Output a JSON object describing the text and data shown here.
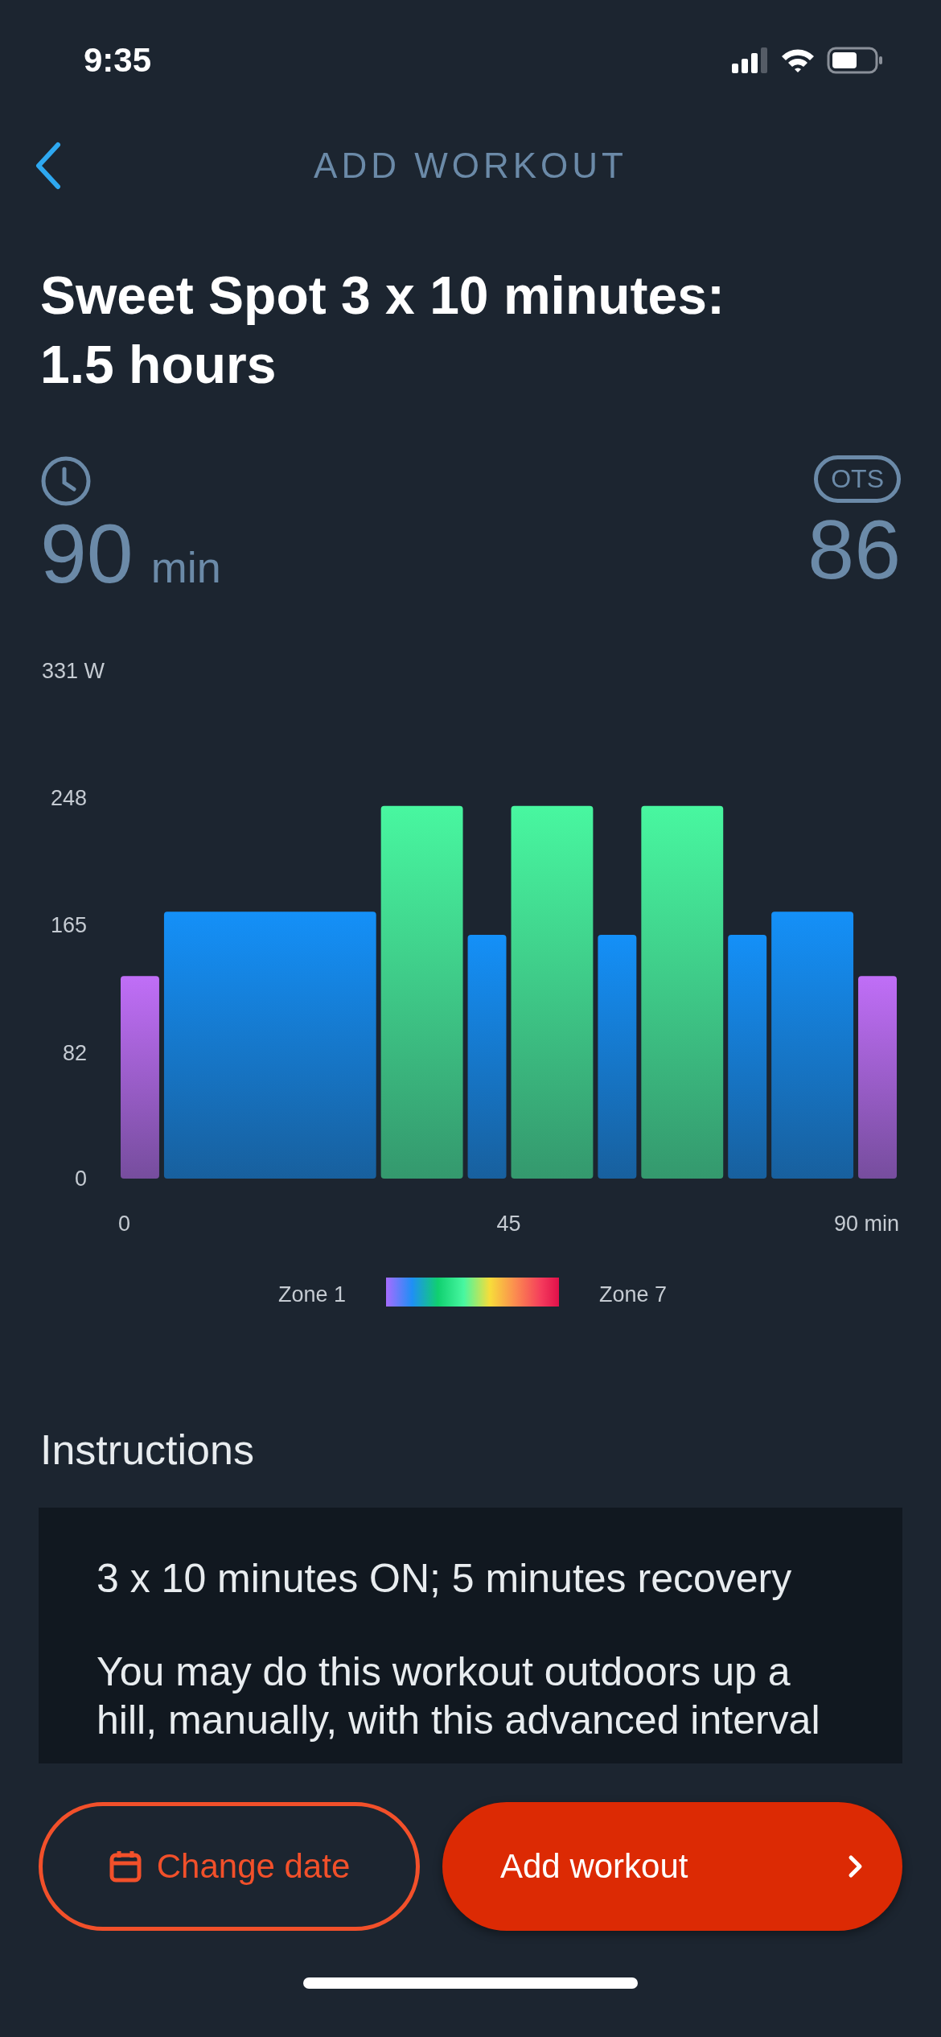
{
  "status_bar": {
    "time": "9:35"
  },
  "nav": {
    "title": "ADD WORKOUT"
  },
  "workout": {
    "title": "Sweet Spot 3 x 10 minutes: 1.5 hours"
  },
  "stats": {
    "duration_value": "90",
    "duration_unit": "min",
    "ots_badge": "OTS",
    "ots_value": "86"
  },
  "power_chart": {
    "chart_data": {
      "type": "bar",
      "ylim": [
        0,
        331
      ],
      "yticks": [
        0,
        82,
        165,
        248,
        {
          "value": 331,
          "label": "331 W"
        }
      ],
      "xlim": [
        0,
        90
      ],
      "xticks": [
        0,
        45,
        {
          "value": 90,
          "label": "90 min"
        }
      ],
      "x": [
        2.5,
        17.5,
        35,
        42.5,
        50,
        57.5,
        65,
        72.5,
        80,
        87.5
      ],
      "values": [
        132,
        174,
        243,
        159,
        243,
        159,
        243,
        159,
        174,
        132
      ],
      "colors": [
        "#c06ef7",
        "#1490f8",
        "#48f7a0",
        "#1490f8",
        "#48f7a0",
        "#1490f8",
        "#48f7a0",
        "#1490f8",
        "#1490f8",
        "#c06ef7"
      ]
    }
  },
  "legend": {
    "start": "Zone 1",
    "end": "Zone 7"
  },
  "instructions": {
    "heading": "Instructions",
    "paragraphs": [
      "3 x 10 minutes ON; 5 minutes recovery",
      "You may do this workout outdoors up a hill, manually, with this advanced interval"
    ]
  },
  "buttons": [
    {
      "kind": "outline",
      "label": "Change date"
    },
    {
      "kind": "filled",
      "label": "Add workout"
    }
  ]
}
